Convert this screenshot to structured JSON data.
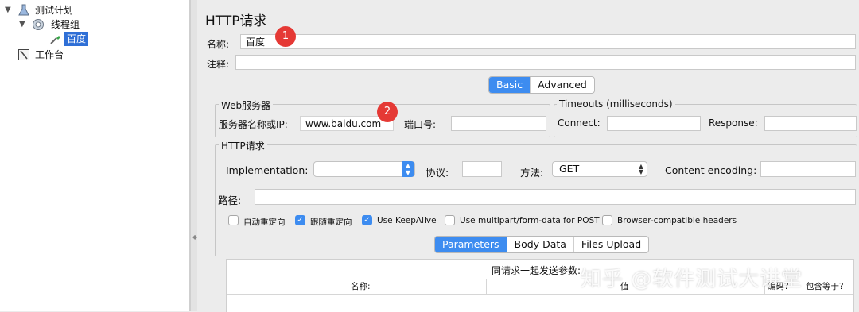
{
  "tree": {
    "items": [
      {
        "label": "测试计划",
        "icon": "test-plan-flask-icon"
      },
      {
        "label": "线程组",
        "icon": "gear-icon"
      },
      {
        "label": "百度",
        "icon": "pipette-sampler-icon"
      },
      {
        "label": "工作台",
        "icon": "workbench-icon"
      }
    ]
  },
  "panel": {
    "title": "HTTP请求",
    "name_label": "名称:",
    "name_value": "百度",
    "comment_label": "注释:",
    "comment_value": ""
  },
  "annotations": {
    "one": "1",
    "two": "2",
    "marker_color": "#e53935"
  },
  "top_tabs": {
    "basic": "Basic",
    "advanced": "Advanced",
    "active": "Basic"
  },
  "web_server": {
    "title": "Web服务器",
    "server_label": "服务器名称或IP:",
    "server_value": "www.baidu.com",
    "port_label": "端口号:",
    "port_value": ""
  },
  "timeouts": {
    "title": "Timeouts (milliseconds)",
    "connect_label": "Connect:",
    "connect_value": "",
    "response_label": "Response:",
    "response_value": ""
  },
  "http_request": {
    "title": "HTTP请求",
    "implementation_label": "Implementation:",
    "implementation_value": "",
    "protocol_label": "协议:",
    "protocol_value": "",
    "method_label": "方法:",
    "method_value": "GET",
    "encoding_label": "Content encoding:",
    "encoding_value": "",
    "path_label": "路径:",
    "path_value": ""
  },
  "options": [
    {
      "label": "自动重定向",
      "checked": false
    },
    {
      "label": "跟随重定向",
      "checked": true
    },
    {
      "label": "Use KeepAlive",
      "checked": true
    },
    {
      "label": "Use multipart/form-data for POST",
      "checked": false
    },
    {
      "label": "Browser-compatible headers",
      "checked": false
    }
  ],
  "sub_tabs": {
    "parameters": "Parameters",
    "body_data": "Body Data",
    "files_upload": "Files Upload",
    "active": "Parameters"
  },
  "params_table": {
    "caption": "同请求一起发送参数:",
    "columns": [
      "名称:",
      "值",
      "编码?",
      "包含等于?"
    ]
  },
  "watermark": "知乎 @软件测试大讲堂",
  "accent_color": "#3d8cf0"
}
